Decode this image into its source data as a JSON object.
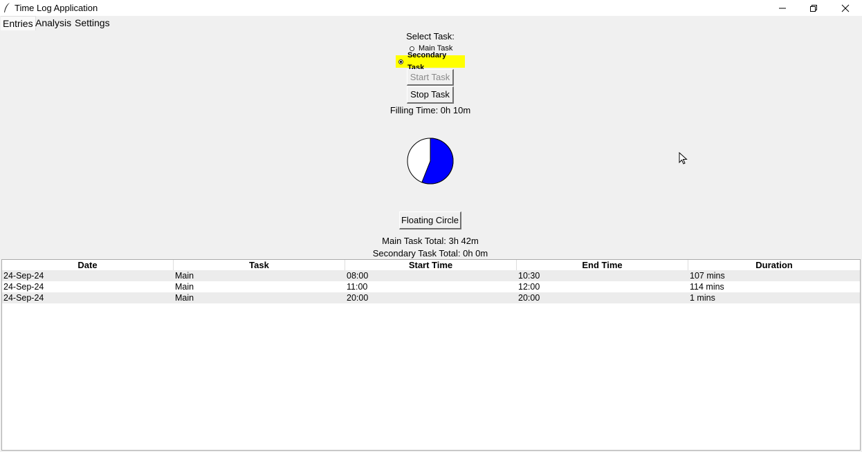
{
  "window": {
    "title": "Time Log Application"
  },
  "tabs": [
    {
      "label": "Entries",
      "active": true
    },
    {
      "label": "Analysis",
      "active": false
    },
    {
      "label": "Settings",
      "active": false
    }
  ],
  "task_select": {
    "heading": "Select Task:",
    "options": [
      {
        "label": "Main Task",
        "selected": false
      },
      {
        "label": "Secondary Task",
        "selected": true
      }
    ],
    "highlight_color": "#ffff00"
  },
  "buttons": {
    "start": "Start Task",
    "stop": "Stop Task",
    "floating": "Floating Circle"
  },
  "filling_time": "Filling Time: 0h 10m",
  "progress_circle": {
    "filled_fraction": 0.56,
    "fill_color": "#0000ff"
  },
  "totals": {
    "main": "Main Task Total: 3h 42m",
    "secondary": "Secondary Task Total: 0h 0m"
  },
  "table": {
    "columns": [
      "Date",
      "Task",
      "Start Time",
      "End Time",
      "Duration"
    ],
    "rows": [
      [
        "24-Sep-24",
        "Main",
        "08:00",
        "10:30",
        "107 mins"
      ],
      [
        "24-Sep-24",
        "Main",
        "11:00",
        "12:00",
        "114 mins"
      ],
      [
        "24-Sep-24",
        "Main",
        "20:00",
        "20:00",
        "1 mins"
      ]
    ]
  }
}
